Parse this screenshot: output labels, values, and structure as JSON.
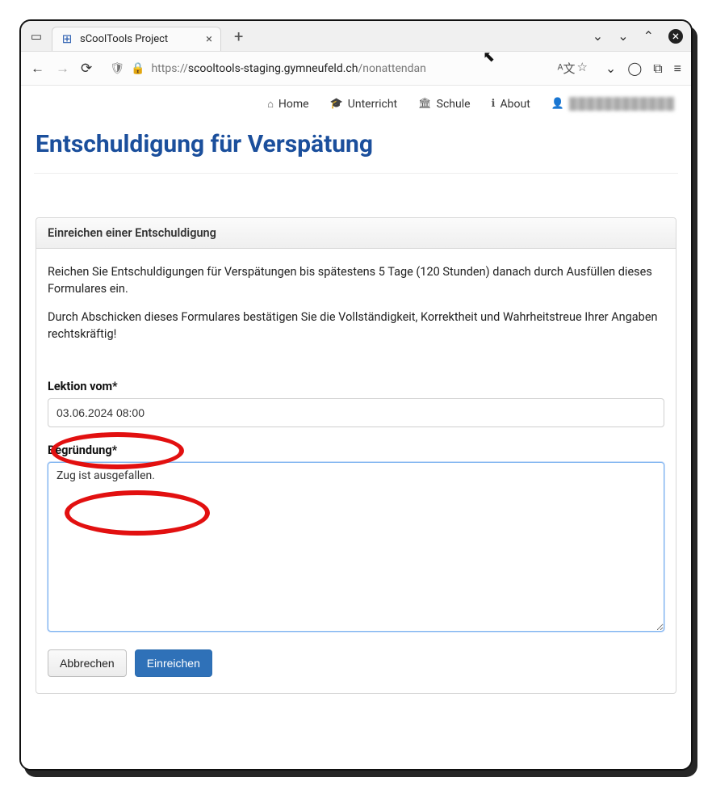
{
  "browser": {
    "tab_title": "sCoolTools Project",
    "url_prefix": "https://",
    "url_host": "scooltools-staging.gymneufeld.ch",
    "url_path": "/nonattendan"
  },
  "nav": {
    "home": "Home",
    "unterricht": "Unterricht",
    "schule": "Schule",
    "about": "About",
    "user": "████████████"
  },
  "page_title": "Entschuldigung für Verspätung",
  "panel": {
    "header": "Einreichen einer Entschuldigung",
    "info1": "Reichen Sie Entschuldigungen für Verspätungen bis spätestens 5 Tage (120 Stunden) danach durch Ausfüllen dieses Formulares ein.",
    "info2": "Durch Abschicken dieses Formulares bestätigen Sie die Vollständigkeit, Korrektheit und Wahrheitstreue Ihrer Angaben rechtskräftig!"
  },
  "form": {
    "lektion_label": "Lektion vom*",
    "lektion_value": "03.06.2024 08:00",
    "begruendung_label": "Begründung*",
    "begruendung_value": "Zug ist ausgefallen.",
    "cancel": "Abbrechen",
    "submit": "Einreichen"
  }
}
